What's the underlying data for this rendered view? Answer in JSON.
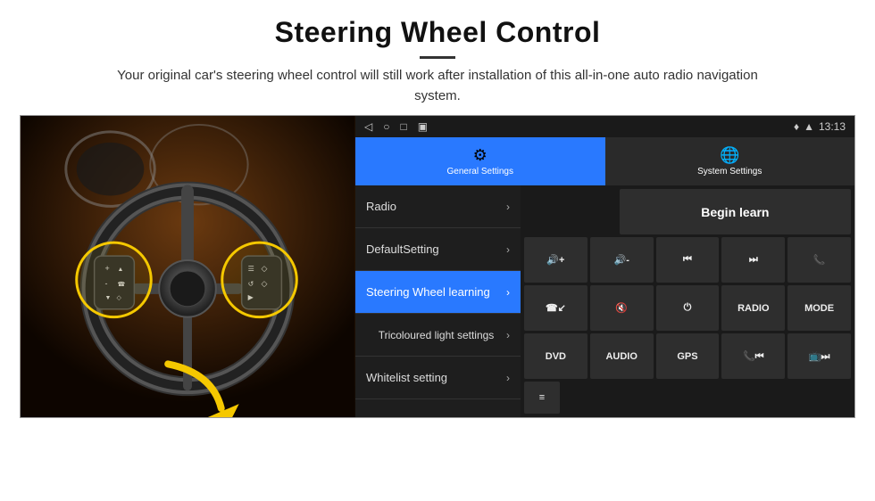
{
  "header": {
    "title": "Steering Wheel Control",
    "subtitle": "Your original car's steering wheel control will still work after installation of this all-in-one auto radio navigation system."
  },
  "statusBar": {
    "time": "13:13",
    "icons": [
      "◁",
      "○",
      "□",
      "▣"
    ]
  },
  "tabs": [
    {
      "id": "general",
      "label": "General Settings",
      "icon": "⚙",
      "active": true
    },
    {
      "id": "system",
      "label": "System Settings",
      "icon": "🌐",
      "active": false
    }
  ],
  "menuItems": [
    {
      "id": "radio",
      "label": "Radio",
      "active": false
    },
    {
      "id": "default",
      "label": "DefaultSetting",
      "active": false
    },
    {
      "id": "steering",
      "label": "Steering Wheel learning",
      "active": true
    },
    {
      "id": "tricoloured",
      "label": "Tricoloured light settings",
      "active": false
    },
    {
      "id": "whitelist",
      "label": "Whitelist setting",
      "active": false
    }
  ],
  "buttonGrid": {
    "topRow": {
      "beginLearn": "Begin learn"
    },
    "row1": [
      "🔊+",
      "🔊-",
      "⏮",
      "⏭",
      "📞"
    ],
    "row2": [
      "📞↙",
      "🔊x",
      "⏻",
      "RADIO",
      "MODE"
    ],
    "row3": [
      "DVD",
      "AUDIO",
      "GPS",
      "📞⏮",
      "📺⏭"
    ],
    "specialIcon": "≡"
  }
}
